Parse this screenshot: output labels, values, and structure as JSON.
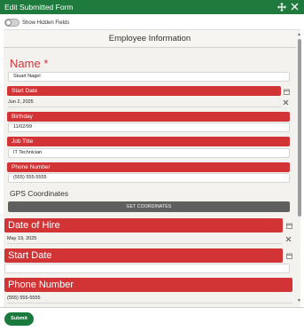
{
  "window": {
    "title": "Edit Submitted Form",
    "move_icon": "move-arrows-icon",
    "close_icon": "close-icon",
    "accent": "#1f7a3e"
  },
  "toggle": {
    "label": "Show Hidden Fields",
    "checked": false
  },
  "form": {
    "header": "Employee Information",
    "label_color": "#d23335",
    "name": {
      "label": "Name",
      "required_mark": "*",
      "value": "Stuart Nagel"
    },
    "start_date_1": {
      "label": "Start Date",
      "value": "Jun 2, 2025"
    },
    "birthday": {
      "label": "Birthday",
      "value": "11/02/99"
    },
    "job_title": {
      "label": "Job Title",
      "value": "IT Technician"
    },
    "phone_1": {
      "label": "Phone Number",
      "value": "(555) 555-5555"
    },
    "gps": {
      "label": "GPS Coordinates",
      "button": "GET COORDINATES",
      "button_color": "#5f5f5f"
    },
    "date_of_hire": {
      "label": "Date of Hire",
      "value": "May 19, 2025"
    },
    "start_date_2": {
      "label": "Start Date",
      "value": ""
    },
    "phone_2": {
      "label": "Phone Number",
      "value": "(555) 555-5555"
    }
  },
  "footer": {
    "submit": "Submit"
  }
}
